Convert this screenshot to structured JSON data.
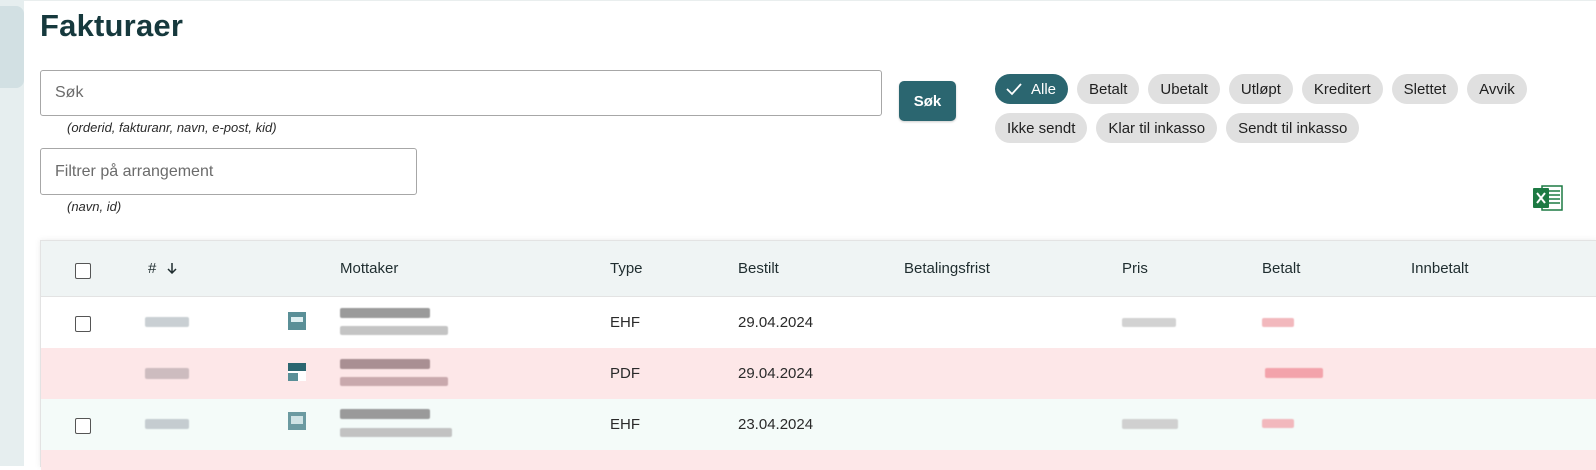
{
  "page": {
    "title": "Fakturaer"
  },
  "search": {
    "placeholder": "Søk",
    "hint": "(orderid, fakturanr, navn, e-post, kid)",
    "button_label": "Søk"
  },
  "event_filter": {
    "placeholder": "Filtrer på arrangement",
    "hint": "(navn, id)"
  },
  "status_filters": [
    {
      "label": "Alle",
      "active": true
    },
    {
      "label": "Betalt",
      "active": false
    },
    {
      "label": "Ubetalt",
      "active": false
    },
    {
      "label": "Utløpt",
      "active": false
    },
    {
      "label": "Kreditert",
      "active": false
    },
    {
      "label": "Slettet",
      "active": false
    },
    {
      "label": "Avvik",
      "active": false
    },
    {
      "label": "Ikke sendt",
      "active": false
    },
    {
      "label": "Klar til inkasso",
      "active": false
    },
    {
      "label": "Sendt til inkasso",
      "active": false
    }
  ],
  "export_icon": "excel-icon",
  "table": {
    "columns": [
      "#",
      "Mottaker",
      "Type",
      "Bestilt",
      "Betalingsfrist",
      "Pris",
      "Betalt",
      "Innbetalt"
    ],
    "sort_icon": "arrow-down-icon",
    "rows": [
      {
        "type": "EHF",
        "ordered": "29.04.2024",
        "status": "normal"
      },
      {
        "type": "PDF",
        "ordered": "29.04.2024",
        "status": "deviation"
      },
      {
        "type": "EHF",
        "ordered": "23.04.2024",
        "status": "paid"
      }
    ]
  },
  "colors": {
    "accent": "#2b6670",
    "title": "#16393d",
    "row_deviation": "#fde7e8",
    "row_paid": "#f4fbf9",
    "header_bg": "#eff4f4"
  }
}
